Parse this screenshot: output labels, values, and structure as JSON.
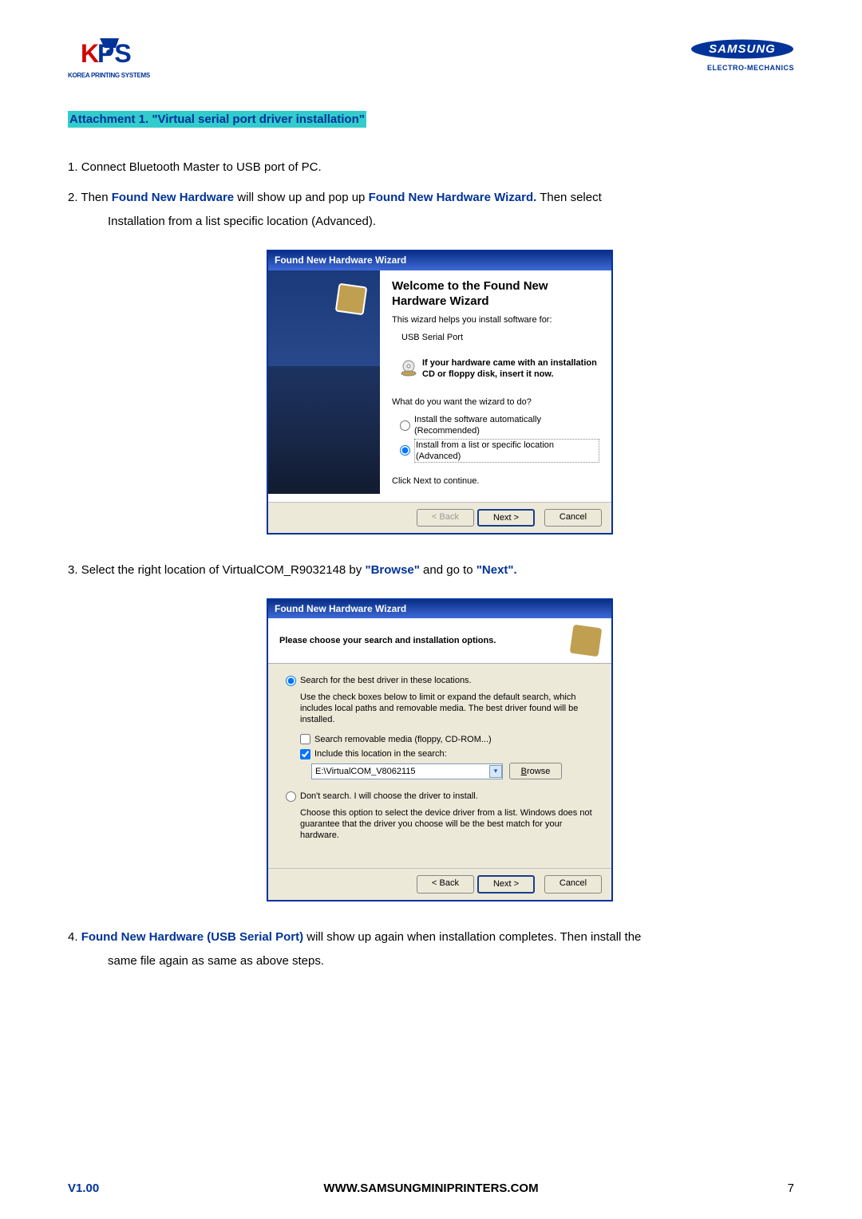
{
  "logo_left_text": "KOREA PRINTING SYSTEMS",
  "logo_right_brand": "SAMSUNG",
  "logo_right_text": "ELECTRO-MECHANICS",
  "attachment_title": "Attachment 1. \"Virtual serial port driver installation\"",
  "steps": {
    "s1_num": "1. ",
    "s1_text": "Connect Bluetooth Master to USB port of PC.",
    "s2_num": "2. ",
    "s2_a": "Then ",
    "s2_b": "Found New Hardware",
    "s2_c": " will show up and pop up ",
    "s2_d": "Found New Hardware Wizard.",
    "s2_e": "    Then select",
    "s2_line2": "Installation from a list specific location (Advanced).",
    "s3_num": "3. ",
    "s3_a": "Select the right location of VirtualCOM_R9032148 by ",
    "s3_b": "\"Browse\"",
    "s3_c": " and go to ",
    "s3_d": "\"Next\".",
    "s4_num": "4. ",
    "s4_a": "Found New Hardware (USB Serial Port)",
    "s4_b": " will show up again when installation completes. Then install the",
    "s4_line2": "same file again as same as above steps."
  },
  "wizard1": {
    "title": "Found New Hardware Wizard",
    "heading": "Welcome to the Found New Hardware Wizard",
    "helps": "This wizard helps you install software for:",
    "device": "USB Serial Port",
    "cd_note": "If your hardware came with an installation CD or floppy disk, insert it now.",
    "question": "What do you want the wizard to do?",
    "opt1": "Install the software automatically (Recommended)",
    "opt2": "Install from a list or specific location (Advanced)",
    "click_next": "Click Next to continue.",
    "back": "< Back",
    "next": "Next >",
    "cancel": "Cancel"
  },
  "wizard2": {
    "title": "Found New Hardware Wizard",
    "header_text": "Please choose your search and installation options.",
    "opt_search": "Search for the best driver in these locations.",
    "search_desc": "Use the check boxes below to limit or expand the default search, which includes local paths and removable media. The best driver found will be installed.",
    "chk_media": "Search removable media (floppy, CD-ROM...)",
    "chk_include": "Include this location in the search:",
    "path_value": "E:\\VirtualCOM_V8062115",
    "browse": "Browse",
    "opt_dont": "Don't search. I will choose the driver to install.",
    "dont_desc": "Choose this option to select the device driver from a list.  Windows does not guarantee that the driver you choose will be the best match for your hardware.",
    "back": "< Back",
    "next": "Next >",
    "cancel": "Cancel"
  },
  "footer": {
    "version": "V1.00",
    "url": "WWW.SAMSUNGMINIPRINTERS.COM",
    "page": "7"
  }
}
